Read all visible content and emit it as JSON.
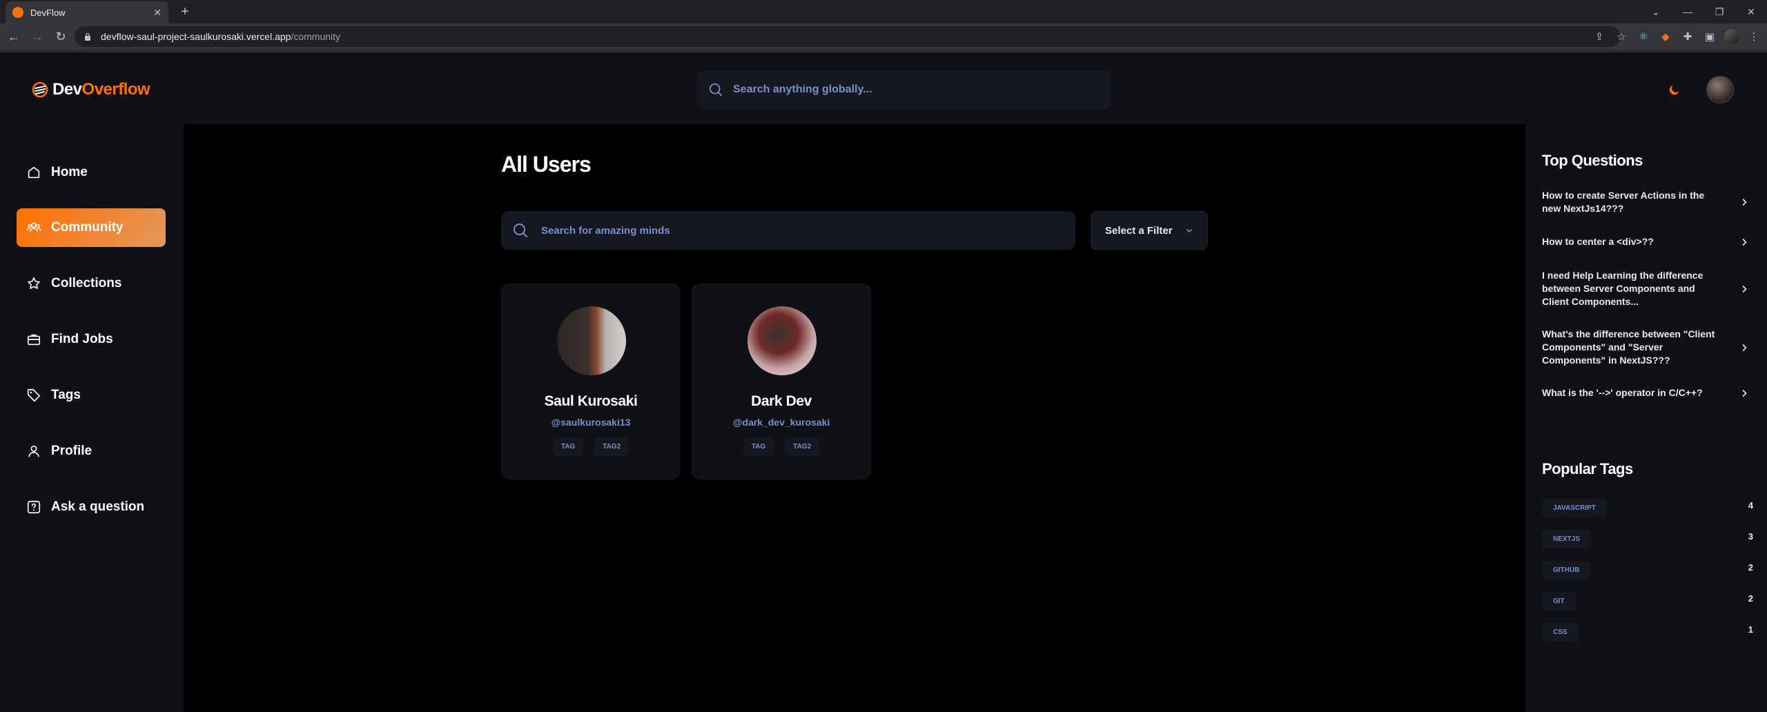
{
  "browser": {
    "tab_title": "DevFlow",
    "url_host": "devflow-saul-project-saulkurosaki.vercel.app",
    "url_path": "/community"
  },
  "app": {
    "logo_dev": "Dev",
    "logo_overflow": "Overflow",
    "global_search_placeholder": "Search anything globally...",
    "brand_color": "#ff7000"
  },
  "sidebar": {
    "items": [
      {
        "label": "Home",
        "icon": "home-icon"
      },
      {
        "label": "Community",
        "icon": "users-icon",
        "active": true
      },
      {
        "label": "Collections",
        "icon": "star-icon"
      },
      {
        "label": "Find Jobs",
        "icon": "suitcase-icon"
      },
      {
        "label": "Tags",
        "icon": "tag-icon"
      },
      {
        "label": "Profile",
        "icon": "user-icon"
      },
      {
        "label": "Ask a question",
        "icon": "question-icon"
      }
    ]
  },
  "main": {
    "title": "All Users",
    "search_placeholder": "Search for amazing minds",
    "filter_label": "Select a Filter",
    "users": [
      {
        "name": "Saul Kurosaki",
        "handle": "@saulkurosaki13",
        "tags": [
          "TAG",
          "TAG2"
        ]
      },
      {
        "name": "Dark Dev",
        "handle": "@dark_dev_kurosaki",
        "tags": [
          "TAG",
          "TAG2"
        ]
      }
    ]
  },
  "right_sidebar": {
    "top_questions_title": "Top Questions",
    "questions": [
      "How to create Server Actions in the new NextJs14???",
      "How to center a <div>??",
      "I need Help Learning the difference between Server Components and Client Components...",
      "What's the difference between \"Client Components\" and \"Server Components\" in NextJS???",
      "What is the '-->' operator in C/C++?"
    ],
    "popular_tags_title": "Popular Tags",
    "tags": [
      {
        "name": "JAVASCRIPT",
        "count": "4"
      },
      {
        "name": "NEXTJS",
        "count": "3"
      },
      {
        "name": "GITHUB",
        "count": "2"
      },
      {
        "name": "GIT",
        "count": "2"
      },
      {
        "name": "CSS",
        "count": "1"
      }
    ]
  }
}
